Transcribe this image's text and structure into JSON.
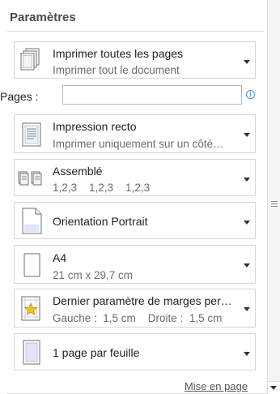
{
  "settings": {
    "title": "Paramètres",
    "pages_label": "Pages :",
    "pages_value": "",
    "info_symbol": "i",
    "page_setup_link": "Mise en page",
    "options": [
      {
        "id": "print-range",
        "title": "Imprimer toutes les pages",
        "subtitle": "Imprimer tout le document",
        "icon": "pages-stack-icon"
      },
      {
        "id": "sides",
        "title": "Impression recto",
        "subtitle": "Imprimer uniquement sur un côté…",
        "icon": "one-sided-page-icon"
      },
      {
        "id": "collation",
        "title": "Assemblé",
        "subtitle": "1,2,3    1,2,3    1,2,3",
        "icon": "collated-icon"
      },
      {
        "id": "orientation",
        "title": "Orientation Portrait",
        "subtitle": "",
        "icon": "portrait-page-icon"
      },
      {
        "id": "paper-size",
        "title": "A4",
        "subtitle": "21 cm x 29,7 cm",
        "icon": "paper-size-icon"
      },
      {
        "id": "margins",
        "title": "Dernier paramètre de marges per…",
        "subtitle": "Gauche :  1,5 cm    Droite :  1,5 cm",
        "icon": "margins-star-icon"
      },
      {
        "id": "pages-per-sheet",
        "title": "1 page par feuille",
        "subtitle": "",
        "icon": "pages-per-sheet-icon"
      }
    ]
  },
  "colors": {
    "border": "#d6d6d6",
    "info": "#4b8fd6",
    "star": "#f2c230"
  }
}
